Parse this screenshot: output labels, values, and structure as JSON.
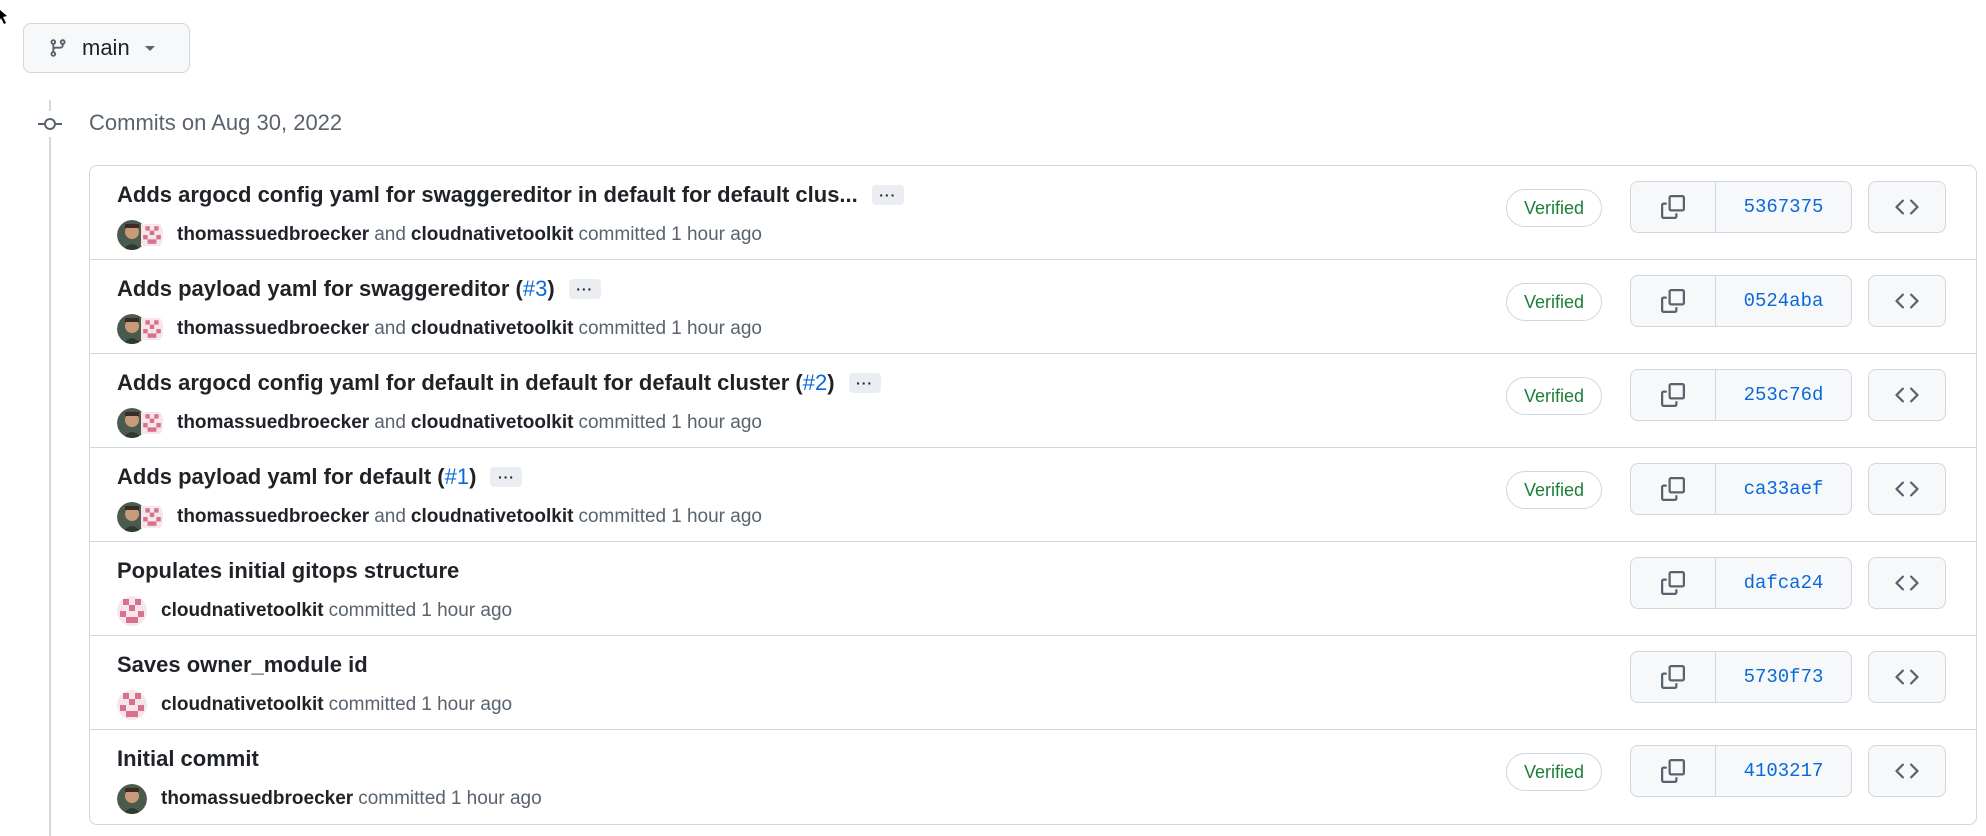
{
  "branch": {
    "name": "main",
    "icon": "git-branch-icon",
    "caret_icon": "triangle-down-icon"
  },
  "timeline": {
    "heading": "Commits on Aug 30, 2022",
    "icon": "git-commit-icon"
  },
  "commits": [
    {
      "message": "Adds argocd config yaml for swaggereditor in default for default clus...",
      "pr": null,
      "authors": [
        "thomassuedbroecker",
        "cloudnativetoolkit"
      ],
      "joiner": "and",
      "committed_text": "committed",
      "time": "1 hour ago",
      "verified": "Verified",
      "sha": "5367375",
      "has_ellipsis": true
    },
    {
      "message": "Adds payload yaml for swaggereditor",
      "pr": "#3",
      "authors": [
        "thomassuedbroecker",
        "cloudnativetoolkit"
      ],
      "joiner": "and",
      "committed_text": "committed",
      "time": "1 hour ago",
      "verified": "Verified",
      "sha": "0524aba",
      "has_ellipsis": true
    },
    {
      "message": "Adds argocd config yaml for default in default for default cluster",
      "pr": "#2",
      "authors": [
        "thomassuedbroecker",
        "cloudnativetoolkit"
      ],
      "joiner": "and",
      "committed_text": "committed",
      "time": "1 hour ago",
      "verified": "Verified",
      "sha": "253c76d",
      "has_ellipsis": true
    },
    {
      "message": "Adds payload yaml for default",
      "pr": "#1",
      "authors": [
        "thomassuedbroecker",
        "cloudnativetoolkit"
      ],
      "joiner": "and",
      "committed_text": "committed",
      "time": "1 hour ago",
      "verified": "Verified",
      "sha": "ca33aef",
      "has_ellipsis": true
    },
    {
      "message": "Populates initial gitops structure",
      "pr": null,
      "authors": [
        "cloudnativetoolkit"
      ],
      "joiner": "",
      "committed_text": "committed",
      "time": "1 hour ago",
      "verified": "",
      "sha": "dafca24",
      "has_ellipsis": false
    },
    {
      "message": "Saves owner_module id",
      "pr": null,
      "authors": [
        "cloudnativetoolkit"
      ],
      "joiner": "",
      "committed_text": "committed",
      "time": "1 hour ago",
      "verified": "",
      "sha": "5730f73",
      "has_ellipsis": false
    },
    {
      "message": "Initial commit",
      "pr": null,
      "authors": [
        "thomassuedbroecker"
      ],
      "joiner": "",
      "committed_text": "committed",
      "time": "1 hour ago",
      "verified": "Verified",
      "sha": "4103217",
      "has_ellipsis": false
    }
  ],
  "icons": {
    "copy": "copy-icon",
    "browse": "code-icon",
    "ellipsis": "ellipsis-icon"
  },
  "colors": {
    "link": "#0969da",
    "verified": "#1a7f37",
    "border": "#d0d7de",
    "muted": "#59636e"
  },
  "ellipsis_label": "···"
}
